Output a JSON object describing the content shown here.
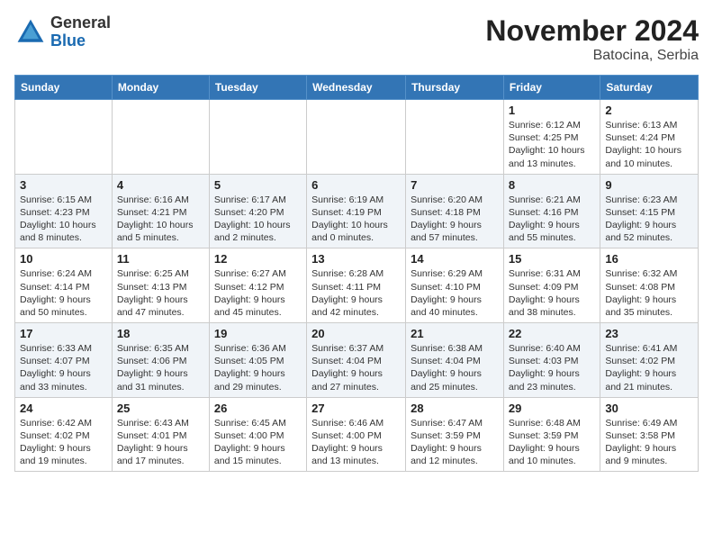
{
  "header": {
    "logo_general": "General",
    "logo_blue": "Blue",
    "month_title": "November 2024",
    "location": "Batocina, Serbia"
  },
  "days_of_week": [
    "Sunday",
    "Monday",
    "Tuesday",
    "Wednesday",
    "Thursday",
    "Friday",
    "Saturday"
  ],
  "weeks": [
    [
      {
        "day": "",
        "info": ""
      },
      {
        "day": "",
        "info": ""
      },
      {
        "day": "",
        "info": ""
      },
      {
        "day": "",
        "info": ""
      },
      {
        "day": "",
        "info": ""
      },
      {
        "day": "1",
        "info": "Sunrise: 6:12 AM\nSunset: 4:25 PM\nDaylight: 10 hours and 13 minutes."
      },
      {
        "day": "2",
        "info": "Sunrise: 6:13 AM\nSunset: 4:24 PM\nDaylight: 10 hours and 10 minutes."
      }
    ],
    [
      {
        "day": "3",
        "info": "Sunrise: 6:15 AM\nSunset: 4:23 PM\nDaylight: 10 hours and 8 minutes."
      },
      {
        "day": "4",
        "info": "Sunrise: 6:16 AM\nSunset: 4:21 PM\nDaylight: 10 hours and 5 minutes."
      },
      {
        "day": "5",
        "info": "Sunrise: 6:17 AM\nSunset: 4:20 PM\nDaylight: 10 hours and 2 minutes."
      },
      {
        "day": "6",
        "info": "Sunrise: 6:19 AM\nSunset: 4:19 PM\nDaylight: 10 hours and 0 minutes."
      },
      {
        "day": "7",
        "info": "Sunrise: 6:20 AM\nSunset: 4:18 PM\nDaylight: 9 hours and 57 minutes."
      },
      {
        "day": "8",
        "info": "Sunrise: 6:21 AM\nSunset: 4:16 PM\nDaylight: 9 hours and 55 minutes."
      },
      {
        "day": "9",
        "info": "Sunrise: 6:23 AM\nSunset: 4:15 PM\nDaylight: 9 hours and 52 minutes."
      }
    ],
    [
      {
        "day": "10",
        "info": "Sunrise: 6:24 AM\nSunset: 4:14 PM\nDaylight: 9 hours and 50 minutes."
      },
      {
        "day": "11",
        "info": "Sunrise: 6:25 AM\nSunset: 4:13 PM\nDaylight: 9 hours and 47 minutes."
      },
      {
        "day": "12",
        "info": "Sunrise: 6:27 AM\nSunset: 4:12 PM\nDaylight: 9 hours and 45 minutes."
      },
      {
        "day": "13",
        "info": "Sunrise: 6:28 AM\nSunset: 4:11 PM\nDaylight: 9 hours and 42 minutes."
      },
      {
        "day": "14",
        "info": "Sunrise: 6:29 AM\nSunset: 4:10 PM\nDaylight: 9 hours and 40 minutes."
      },
      {
        "day": "15",
        "info": "Sunrise: 6:31 AM\nSunset: 4:09 PM\nDaylight: 9 hours and 38 minutes."
      },
      {
        "day": "16",
        "info": "Sunrise: 6:32 AM\nSunset: 4:08 PM\nDaylight: 9 hours and 35 minutes."
      }
    ],
    [
      {
        "day": "17",
        "info": "Sunrise: 6:33 AM\nSunset: 4:07 PM\nDaylight: 9 hours and 33 minutes."
      },
      {
        "day": "18",
        "info": "Sunrise: 6:35 AM\nSunset: 4:06 PM\nDaylight: 9 hours and 31 minutes."
      },
      {
        "day": "19",
        "info": "Sunrise: 6:36 AM\nSunset: 4:05 PM\nDaylight: 9 hours and 29 minutes."
      },
      {
        "day": "20",
        "info": "Sunrise: 6:37 AM\nSunset: 4:04 PM\nDaylight: 9 hours and 27 minutes."
      },
      {
        "day": "21",
        "info": "Sunrise: 6:38 AM\nSunset: 4:04 PM\nDaylight: 9 hours and 25 minutes."
      },
      {
        "day": "22",
        "info": "Sunrise: 6:40 AM\nSunset: 4:03 PM\nDaylight: 9 hours and 23 minutes."
      },
      {
        "day": "23",
        "info": "Sunrise: 6:41 AM\nSunset: 4:02 PM\nDaylight: 9 hours and 21 minutes."
      }
    ],
    [
      {
        "day": "24",
        "info": "Sunrise: 6:42 AM\nSunset: 4:02 PM\nDaylight: 9 hours and 19 minutes."
      },
      {
        "day": "25",
        "info": "Sunrise: 6:43 AM\nSunset: 4:01 PM\nDaylight: 9 hours and 17 minutes."
      },
      {
        "day": "26",
        "info": "Sunrise: 6:45 AM\nSunset: 4:00 PM\nDaylight: 9 hours and 15 minutes."
      },
      {
        "day": "27",
        "info": "Sunrise: 6:46 AM\nSunset: 4:00 PM\nDaylight: 9 hours and 13 minutes."
      },
      {
        "day": "28",
        "info": "Sunrise: 6:47 AM\nSunset: 3:59 PM\nDaylight: 9 hours and 12 minutes."
      },
      {
        "day": "29",
        "info": "Sunrise: 6:48 AM\nSunset: 3:59 PM\nDaylight: 9 hours and 10 minutes."
      },
      {
        "day": "30",
        "info": "Sunrise: 6:49 AM\nSunset: 3:58 PM\nDaylight: 9 hours and 9 minutes."
      }
    ]
  ]
}
